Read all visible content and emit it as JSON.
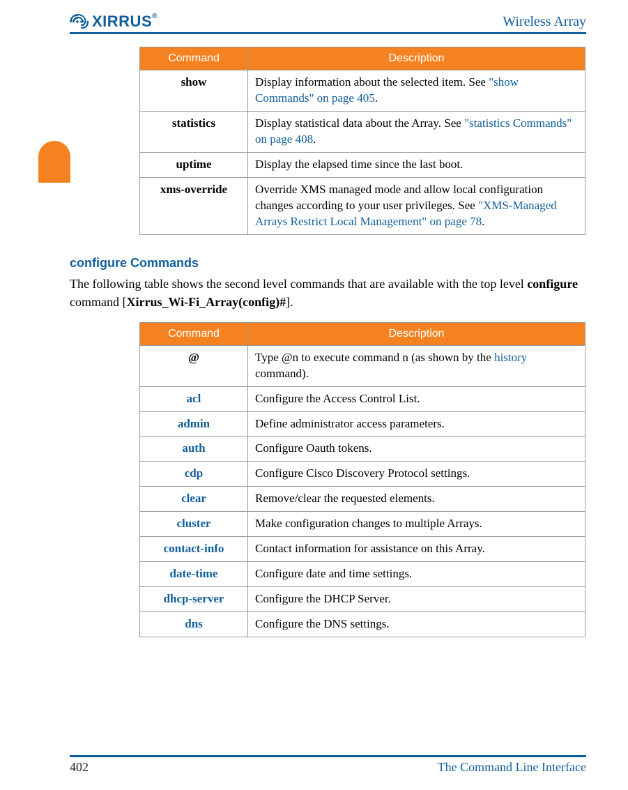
{
  "header": {
    "logo_text": "XIRRUS",
    "logo_reg": "®",
    "title": "Wireless Array"
  },
  "table1": {
    "headers": [
      "Command",
      "Description"
    ],
    "rows": [
      {
        "cmd": "show",
        "desc_pre": "Display information about the selected item. See ",
        "desc_link": "\"show Commands\" on page 405",
        "desc_post": "."
      },
      {
        "cmd": "statistics",
        "desc_pre": "Display statistical data about the Array. See ",
        "desc_link": "\"statistics Commands\" on page 408",
        "desc_post": "."
      },
      {
        "cmd": "uptime",
        "desc_pre": "Display the elapsed time since the last boot.",
        "desc_link": "",
        "desc_post": ""
      },
      {
        "cmd": "xms-override",
        "desc_pre": "Override XMS managed mode and allow local configuration changes according to your user privileges. See ",
        "desc_link": "\"XMS-Managed Arrays Restrict Local Management\" on page 78",
        "desc_post": "."
      }
    ]
  },
  "section": {
    "heading": "configure Commands",
    "para_pre": "The following table shows the second level commands that are available with the top level ",
    "para_bold1": "configure",
    "para_mid": " command [",
    "para_bold2": "Xirrus_Wi-Fi_Array(config)#",
    "para_post": "]."
  },
  "table2": {
    "headers": [
      "Command",
      "Description"
    ],
    "rows": [
      {
        "cmd": "@",
        "cmd_link": false,
        "desc_pre": "Type ",
        "desc_bold": "@n",
        "desc_mid": " to execute command n (as shown by the ",
        "desc_link": "history",
        "desc_post": " command)."
      },
      {
        "cmd": "acl",
        "cmd_link": true,
        "desc": "Configure the Access Control List."
      },
      {
        "cmd": "admin",
        "cmd_link": true,
        "desc": "Define administrator access parameters."
      },
      {
        "cmd": "auth",
        "cmd_link": true,
        "desc": " Configure Oauth tokens."
      },
      {
        "cmd": "cdp",
        "cmd_link": true,
        "desc": " Configure Cisco Discovery Protocol settings."
      },
      {
        "cmd": "clear",
        "cmd_link": true,
        "desc": "Remove/clear the requested elements."
      },
      {
        "cmd": "cluster",
        "cmd_link": true,
        "desc": "Make configuration changes to multiple Arrays."
      },
      {
        "cmd": "contact-info",
        "cmd_link": true,
        "desc": "Contact information for assistance on this Array."
      },
      {
        "cmd": "date-time",
        "cmd_link": true,
        "desc": "Configure date and time settings."
      },
      {
        "cmd": "dhcp-server",
        "cmd_link": true,
        "desc": "Configure the DHCP Server."
      },
      {
        "cmd": "dns",
        "cmd_link": true,
        "desc": "Configure the DNS settings."
      }
    ]
  },
  "footer": {
    "page": "402",
    "section": "The Command Line Interface"
  }
}
